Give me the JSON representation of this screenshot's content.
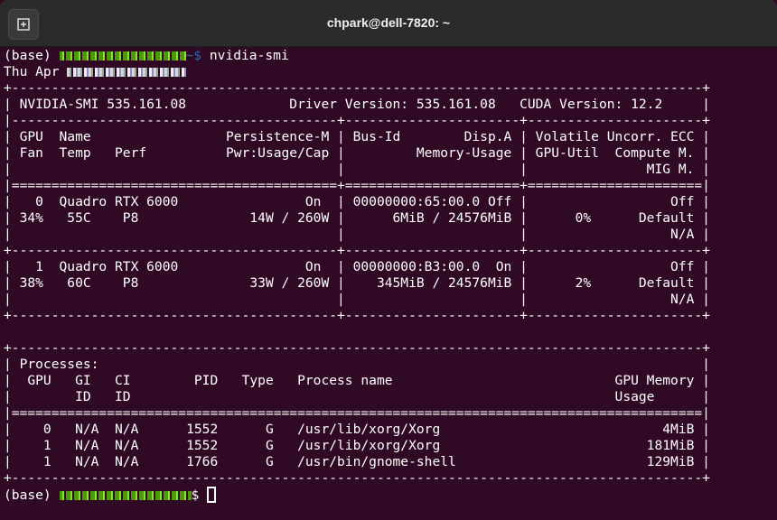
{
  "window": {
    "title": "chpark@dell-7820: ~",
    "new_tab_icon": "new-tab-icon"
  },
  "prompt1": {
    "env": "(base) ",
    "suffix": "~$ ",
    "command": "nvidia-smi"
  },
  "date_line": "Thu Apr ",
  "smi_lines": [
    "+---------------------------------------------------------------------------------------+",
    "| NVIDIA-SMI 535.161.08             Driver Version: 535.161.08   CUDA Version: 12.2     |",
    "|-----------------------------------------+----------------------+----------------------+",
    "| GPU  Name                 Persistence-M | Bus-Id        Disp.A | Volatile Uncorr. ECC |",
    "| Fan  Temp   Perf          Pwr:Usage/Cap |         Memory-Usage | GPU-Util  Compute M. |",
    "|                                         |                      |               MIG M. |",
    "|=========================================+======================+======================|",
    "|   0  Quadro RTX 6000                On  | 00000000:65:00.0 Off |                  Off |",
    "| 34%   55C    P8              14W / 260W |      6MiB / 24576MiB |      0%      Default |",
    "|                                         |                      |                  N/A |",
    "+-----------------------------------------+----------------------+----------------------+",
    "|   1  Quadro RTX 6000                On  | 00000000:B3:00.0  On |                  Off |",
    "| 38%   60C    P8              33W / 260W |    345MiB / 24576MiB |      2%      Default |",
    "|                                         |                      |                  N/A |",
    "+-----------------------------------------+----------------------+----------------------+",
    "",
    "+---------------------------------------------------------------------------------------+",
    "| Processes:                                                                            |",
    "|  GPU   GI   CI        PID   Type   Process name                            GPU Memory |",
    "|        ID   ID                                                             Usage      |",
    "|=======================================================================================|",
    "|    0   N/A  N/A      1552      G   /usr/lib/xorg/Xorg                            4MiB |",
    "|    1   N/A  N/A      1552      G   /usr/lib/xorg/Xorg                          181MiB |",
    "|    1   N/A  N/A      1766      G   /usr/bin/gnome-shell                        129MiB |",
    "+---------------------------------------------------------------------------------------+"
  ],
  "prompt2": {
    "env": "(base) ",
    "suffix": "$ "
  },
  "colors": {
    "background": "#300a24",
    "titlebar": "#2b2b2b",
    "text": "#ffffff",
    "prompt_user": "#4e9a06",
    "prompt_path": "#3465a4"
  }
}
